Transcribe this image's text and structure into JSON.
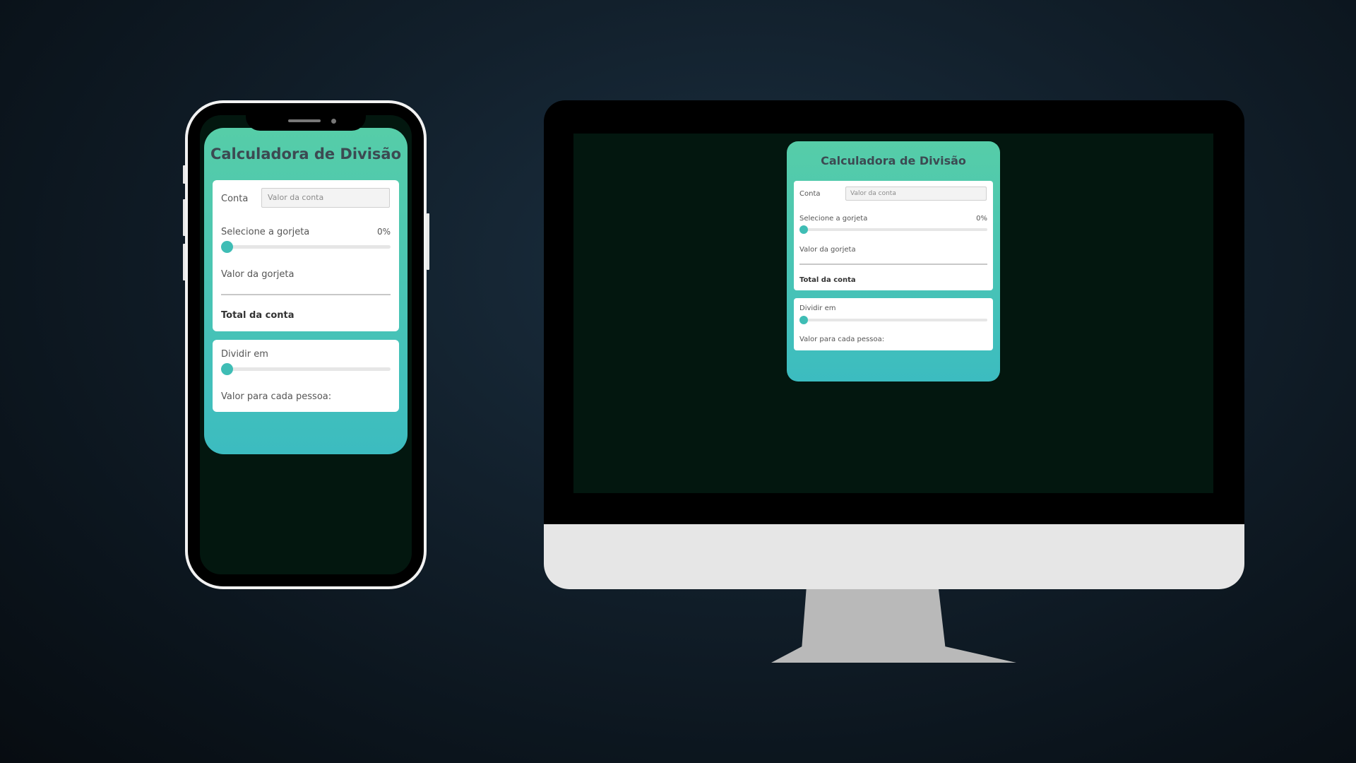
{
  "app": {
    "title": "Calculadora de Divisão",
    "bill_label": "Conta",
    "bill_placeholder": "Valor da conta",
    "tip_select_label": "Selecione a gorjeta",
    "tip_percent": "0%",
    "tip_slider_level": 0,
    "tip_value_label": "Valor da gorjeta",
    "total_label": "Total da conta",
    "split_label": "Dividir em",
    "split_slider_level": 0,
    "per_person_label": "Valor para cada pessoa:"
  },
  "colors": {
    "background": "#0b141c",
    "screen": "#03170f",
    "app_gradient_top": "#56cda8",
    "app_gradient_bottom": "#3cbcc0",
    "accent": "#3fbdb5"
  }
}
